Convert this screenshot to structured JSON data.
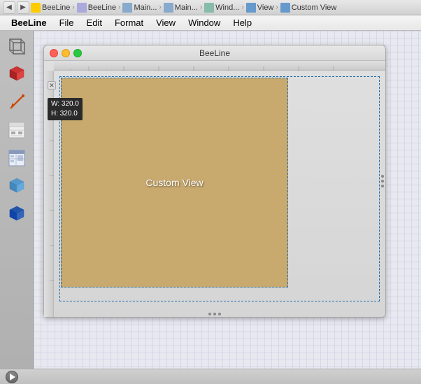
{
  "topToolbar": {
    "navBackLabel": "◀",
    "navForwardLabel": "▶",
    "breadcrumbs": [
      {
        "label": "BeeLine",
        "iconType": "bee"
      },
      {
        "label": "BeeLine",
        "iconType": "file"
      },
      {
        "label": "Main...",
        "iconType": "grid"
      },
      {
        "label": "Main...",
        "iconType": "grid"
      },
      {
        "label": "Wind...",
        "iconType": "window"
      },
      {
        "label": "View",
        "iconType": "view"
      },
      {
        "label": "Custom View",
        "iconType": "custom"
      }
    ]
  },
  "menuBar": {
    "items": [
      {
        "label": "BeeLine",
        "id": "beeline"
      },
      {
        "label": "File",
        "id": "file"
      },
      {
        "label": "Edit",
        "id": "edit"
      },
      {
        "label": "Format",
        "id": "format"
      },
      {
        "label": "View",
        "id": "view"
      },
      {
        "label": "Window",
        "id": "window"
      },
      {
        "label": "Help",
        "id": "help"
      }
    ]
  },
  "tools": [
    {
      "id": "select-3d",
      "shape": "cube-wire"
    },
    {
      "id": "box-3d",
      "shape": "cube-solid-red"
    },
    {
      "id": "arrow-tool",
      "shape": "arrow-diag"
    },
    {
      "id": "template-tool",
      "shape": "template"
    },
    {
      "id": "layout-tool",
      "shape": "layout-grid"
    },
    {
      "id": "cube-blue",
      "shape": "cube-blue"
    },
    {
      "id": "cube-dark",
      "shape": "cube-dark-blue"
    }
  ],
  "window": {
    "title": "BeeLine",
    "sizeBadge": {
      "width": "W: 320.0",
      "height": "H: 320.0"
    }
  },
  "canvas": {
    "customViewLabel": "Custom View"
  },
  "bottomBar": {
    "playButton": "▶"
  }
}
